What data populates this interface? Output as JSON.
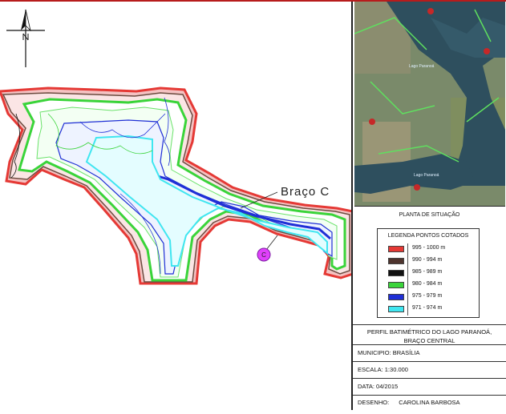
{
  "map": {
    "arm_label": "Braço C",
    "point_marker": "C"
  },
  "situation": {
    "title": "PLANTA DE SITUAÇÃO",
    "places": [
      "Lago Paranoá",
      "Lago Paranoá"
    ]
  },
  "legend": {
    "title": "LEGENDA PONTOS COTADOS",
    "items": [
      {
        "color": "#e53935",
        "range": "995 - 1000 m"
      },
      {
        "color": "#4e342e",
        "range": "990 - 994 m"
      },
      {
        "color": "#111111",
        "range": "985 - 989 m"
      },
      {
        "color": "#3ad43a",
        "range": "980 - 984 m"
      },
      {
        "color": "#1f2fd6",
        "range": "975 - 979 m"
      },
      {
        "color": "#3fe6f0",
        "range": "971 - 974 m"
      }
    ]
  },
  "titleblock": {
    "title_line1": "PERFIL BATIMÉTRICO DO LAGO PARANOÁ,",
    "title_line2": "BRAÇO CENTRAL",
    "municipio": "MUNICIPIO: BRASÍLIA",
    "escala": "ESCALA: 1:30.000",
    "data": "DATA: 04/2015",
    "desenho_label": "DESENHO:",
    "desenho_value": "CAROLINA BARBOSA"
  }
}
